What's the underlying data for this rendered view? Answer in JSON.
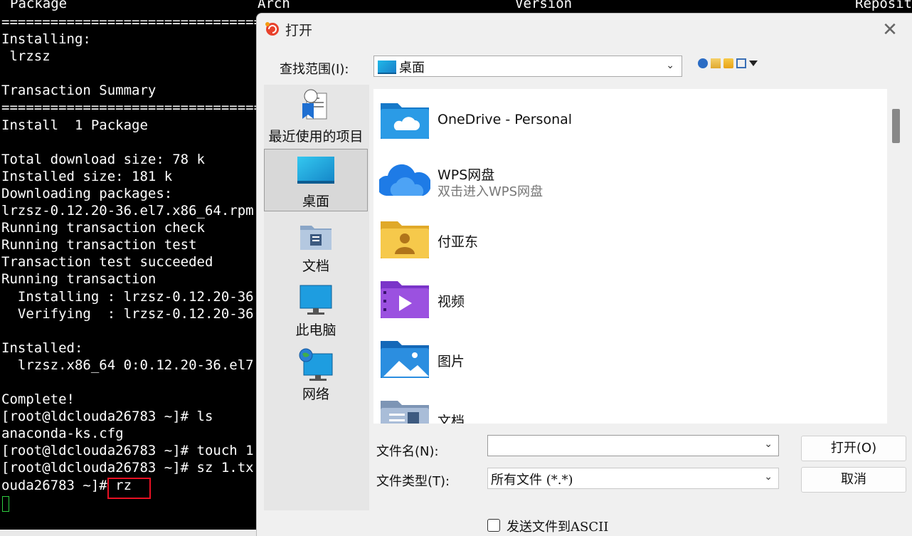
{
  "terminal": {
    "header": {
      "col1": "Package",
      "col2": "Arch",
      "col3": "Version",
      "col4": "Reposit"
    },
    "lines": [
      "=================================",
      "Installing:",
      " lrzsz",
      "",
      "Transaction Summary",
      "=================================",
      "Install  1 Package",
      "",
      "Total download size: 78 k",
      "Installed size: 181 k",
      "Downloading packages:",
      "lrzsz-0.12.20-36.el7.x86_64.rpm",
      "Running transaction check",
      "Running transaction test",
      "Transaction test succeeded",
      "Running transaction",
      "  Installing : lrzsz-0.12.20-36",
      "  Verifying  : lrzsz-0.12.20-36",
      "",
      "Installed:",
      "  lrzsz.x86_64 0:0.12.20-36.el7",
      "",
      "Complete!",
      "[root@ldclouda26783 ~]# ls",
      "anaconda-ks.cfg",
      "[root@ldclouda26783 ~]# touch 1",
      "[root@ldclouda26783 ~]# sz 1.tx",
      "ouda26783 ~]# rz"
    ]
  },
  "dialog": {
    "title": "打开",
    "close_symbol": "✕",
    "look_in_label": "查找范围(I):",
    "look_in_value": "桌面",
    "places": [
      {
        "label": "最近使用的项目"
      },
      {
        "label": "桌面"
      },
      {
        "label": "文档"
      },
      {
        "label": "此电脑"
      },
      {
        "label": "网络"
      }
    ],
    "files": [
      {
        "name": "OneDrive - Personal",
        "sub": ""
      },
      {
        "name": "WPS网盘",
        "sub": "双击进入WPS网盘"
      },
      {
        "name": "付亚东",
        "sub": ""
      },
      {
        "name": "视频",
        "sub": ""
      },
      {
        "name": "图片",
        "sub": ""
      },
      {
        "name": "文档",
        "sub": ""
      }
    ],
    "file_name_label": "文件名(N):",
    "file_name_value": "",
    "file_type_label": "文件类型(T):",
    "file_type_value": "所有文件 (*.*)",
    "open_button": "打开(O)",
    "cancel_button": "取消",
    "ascii_checkbox_label": "发送文件到ASCII",
    "ascii_checked": false
  },
  "colors": {
    "terminal_bg": "#000000",
    "terminal_fg": "#ffffff",
    "highlight_box": "#e81123",
    "dialog_bg": "#f0f0f0",
    "cursor_green": "#2ecc40"
  }
}
